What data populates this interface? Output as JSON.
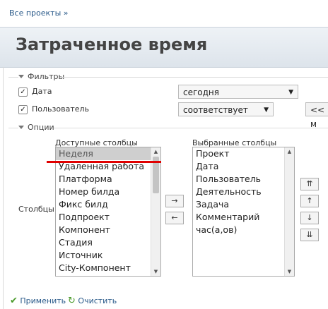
{
  "breadcrumb": "Все проекты »",
  "title": "Затраченное время",
  "filters": {
    "legend": "Фильтры",
    "rows": [
      {
        "label": "Дата",
        "checked": true,
        "operator": "сегодня"
      },
      {
        "label": "Пользователь",
        "checked": true,
        "operator": "соответствует",
        "extra_button": "<< м"
      }
    ]
  },
  "options": {
    "legend": "Опции",
    "columns_label": "Столбцы",
    "available_label": "Доступные столбцы",
    "selected_label": "Выбранные столбцы",
    "available": [
      "Неделя",
      "Удаленная работа",
      "Платформа",
      "Номер билда",
      "Фикс билд",
      "Подпроект",
      "Компонент",
      "Стадия",
      "Источник",
      "City-Компонент"
    ],
    "selected": [
      "Проект",
      "Дата",
      "Пользователь",
      "Деятельность",
      "Задача",
      "Комментарий",
      "час(а,ов)"
    ],
    "move_right": "→",
    "move_left": "←",
    "order_buttons": [
      "⇈",
      "↑",
      "↓",
      "⇊"
    ]
  },
  "actions": {
    "apply": "Применить",
    "clear": "Очистить"
  }
}
